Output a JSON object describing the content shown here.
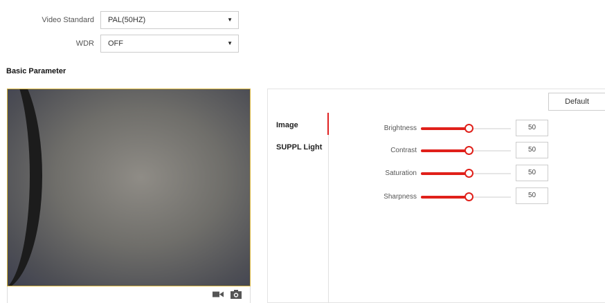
{
  "video_standard": {
    "label": "Video Standard",
    "value": "PAL(50HZ)"
  },
  "wdr": {
    "label": "WDR",
    "value": "OFF"
  },
  "section_title": "Basic Parameter",
  "panel": {
    "default_label": "Default",
    "tabs": [
      {
        "label": "Image",
        "active": true
      },
      {
        "label": "SUPPL Light",
        "active": false
      }
    ],
    "sliders": [
      {
        "label": "Brightness",
        "value": "50"
      },
      {
        "label": "Contrast",
        "value": "50"
      },
      {
        "label": "Saturation",
        "value": "50"
      },
      {
        "label": "Sharpness",
        "value": "50"
      }
    ]
  },
  "preview_tools": [
    "video-camera-icon",
    "camera-icon"
  ],
  "colors": {
    "accent": "#e0201a",
    "preview_border": "#d9b640"
  }
}
